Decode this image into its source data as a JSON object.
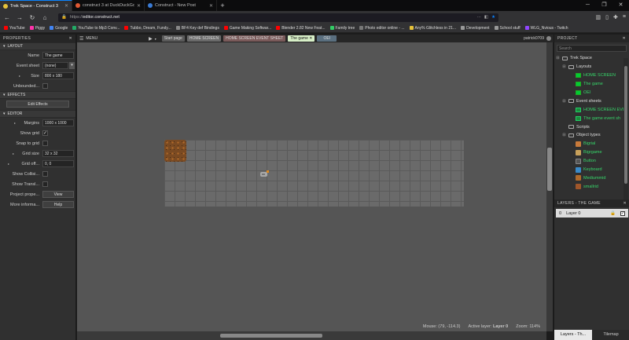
{
  "browser": {
    "tabs": [
      {
        "title": "Trek Space - Construct 3",
        "active": true,
        "color": "#e6c23a"
      },
      {
        "title": "construct 3 at DuckDuckGo",
        "active": false,
        "color": "#de5833"
      },
      {
        "title": "Construct - New Post",
        "active": false,
        "color": "#3a7bd5"
      }
    ],
    "url_prefix": "https://",
    "url_host": "editor.construct.net",
    "bookmarks": [
      {
        "label": "YouTube",
        "color": "#ff0000"
      },
      {
        "label": "Piggy",
        "color": "#f3a"
      },
      {
        "label": "Google",
        "color": "#4285f4"
      },
      {
        "label": "YouTube to Mp3 Conv...",
        "color": "#2a6"
      },
      {
        "label": "Tubbo, Dream, Fundy...",
        "color": "#ff0000"
      },
      {
        "label": "BF4 Key def Bindings",
        "color": "#888"
      },
      {
        "label": "Game Making Softwar...",
        "color": "#ff0000"
      },
      {
        "label": "Blender 2.82 New Feat...",
        "color": "#ff0000"
      },
      {
        "label": "Family tree",
        "color": "#3c6"
      },
      {
        "label": "Photo editor online - ...",
        "color": "#777"
      },
      {
        "label": "Any% Glitchless in 21...",
        "color": "#e6c23a"
      },
      {
        "label": "Development",
        "color": "#999"
      },
      {
        "label": "School stuff",
        "color": "#999"
      },
      {
        "label": "WLG_Nvious - Twitch",
        "color": "#9146ff"
      }
    ]
  },
  "properties": {
    "title": "PROPERTIES",
    "layout_section": "LAYOUT",
    "name_label": "Name",
    "name_value": "The game",
    "event_sheet_label": "Event sheet",
    "event_sheet_value": "(none)",
    "size_label": "Size",
    "size_value": "800 x 180",
    "unbounded_label": "Unbounded...",
    "effects_section": "EFFECTS",
    "edit_effects": "Edit Effects",
    "editor_section": "EDITOR",
    "margins_label": "Margins",
    "margins_value": "1000 x 1000",
    "show_grid_label": "Show grid",
    "snap_grid_label": "Snap to grid",
    "grid_size_label": "Grid size",
    "grid_size_value": "32 x 32",
    "grid_offset_label": "Grid off...",
    "grid_offset_value": "0, 0",
    "show_collisions_label": "Show Collisi...",
    "show_translucent_label": "Show Transl...",
    "project_props_label": "Project prope...",
    "view_button": "View",
    "more_info_label": "More informa...",
    "help_button": "Help"
  },
  "editor": {
    "menu": "MENU",
    "tabs": [
      {
        "label": "Start page",
        "bg": "#5a5a5a",
        "fg": "#ddd"
      },
      {
        "label": "HOME SCREEN",
        "bg": "#6a6a6a",
        "fg": "#ddd"
      },
      {
        "label": "HOME SCREEN EVENT SHEET",
        "bg": "#7a5a5a",
        "fg": "#ddd"
      },
      {
        "label": "The game",
        "bg": "#d8f0c8",
        "fg": "#111"
      },
      {
        "label": "OEI",
        "bg": "#5a6f7f",
        "fg": "#ddd"
      }
    ],
    "user": "patrick0709",
    "status_mouse": "Mouse: (79, -114.3)",
    "status_layer_label": "Active layer:",
    "status_layer": "Layer 0",
    "status_zoom": "Zoom: 114%"
  },
  "project": {
    "title": "PROJECT",
    "search_placeholder": "Search",
    "root": "Trek Space",
    "layouts_folder": "Layouts",
    "layouts": [
      "HOME SCREEN",
      "The game",
      "OEI"
    ],
    "event_sheets_folder": "Event sheets",
    "event_sheets": [
      "HOME SCREEN EVE",
      "The game event sh"
    ],
    "scripts_folder": "Scripts",
    "object_types_folder": "Object types",
    "objects": [
      {
        "name": "Bigrial",
        "color": "#c87a3a"
      },
      {
        "name": "Bigrgame",
        "color": "#c8a05a"
      },
      {
        "name": "Button",
        "color": "#555"
      },
      {
        "name": "Keyboard",
        "color": "#3a8ac8"
      },
      {
        "name": "Mediummid",
        "color": "#b06a2a"
      },
      {
        "name": "smallrid",
        "color": "#a0562a"
      }
    ]
  },
  "layers": {
    "title": "LAYERS - THE GAME",
    "rows": [
      {
        "index": "0",
        "name": "Layer 0"
      }
    ],
    "bottom_tabs": [
      "Layers - Th...",
      "Tilemap"
    ]
  }
}
